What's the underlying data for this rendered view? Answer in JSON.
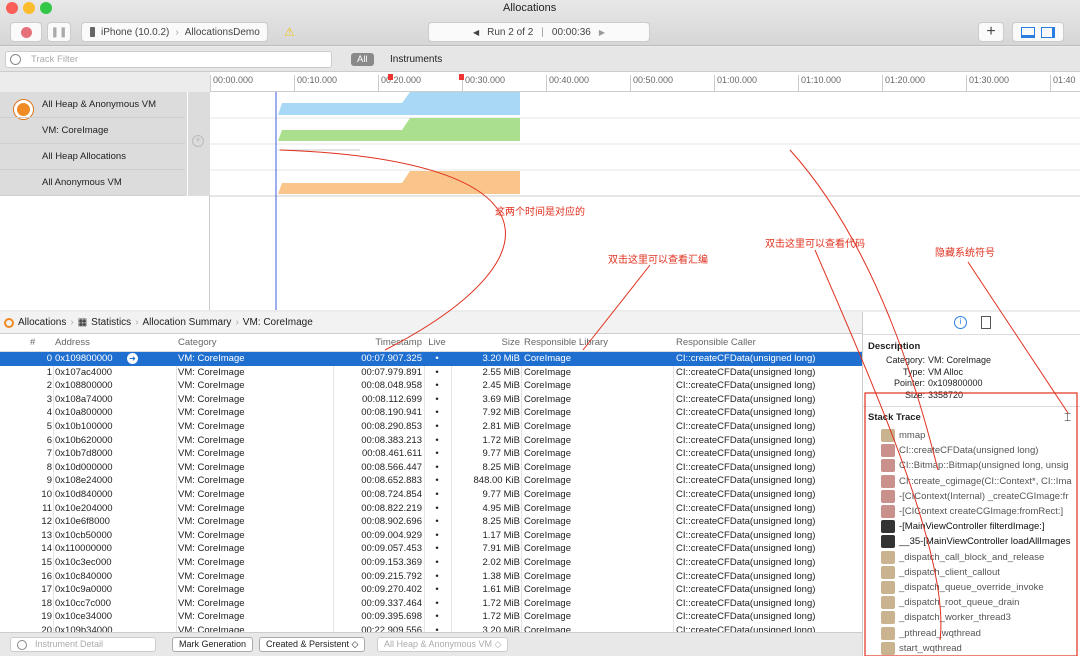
{
  "window": {
    "title": "Allocations",
    "device": "iPhone (10.0.2)",
    "target": "AllocationsDemo",
    "run": "Run 2 of 2",
    "elapsed": "00:00:36",
    "prev": "◀",
    "next": "▶",
    "add": "+"
  },
  "filter": {
    "placeholder": "Track Filter",
    "all": "All",
    "instruments": "Instruments"
  },
  "ruler": [
    "00:00.000",
    "00:10.000",
    "00:20.000",
    "00:30.000",
    "00:40.000",
    "00:50.000",
    "01:00.000",
    "01:10.000",
    "01:20.000",
    "01:30.000",
    "01:40"
  ],
  "tracks": [
    "All Heap & Anonymous VM",
    "VM: CoreImage",
    "All Heap Allocations",
    "All Anonymous VM"
  ],
  "colors": {
    "blue": "#a8d8f5",
    "green": "#a9df8d",
    "orange": "#f9c58b",
    "selection": "#1f6fd0",
    "annotation": "#e0301e"
  },
  "breadcrumb": [
    "Allocations",
    "Statistics",
    "Allocation Summary",
    "VM: CoreImage"
  ],
  "table": {
    "headers": [
      "#",
      "Address",
      "Category",
      "Timestamp",
      "Live",
      "Size",
      "Responsible Library",
      "Responsible Caller"
    ],
    "rows": [
      [
        "0",
        "0x109800000",
        "VM: CoreImage",
        "00:07.907.325",
        "•",
        "3.20 MiB",
        "CoreImage",
        "CI::createCFData(unsigned long)"
      ],
      [
        "1",
        "0x107ac4000",
        "VM: CoreImage",
        "00:07.979.891",
        "•",
        "2.55 MiB",
        "CoreImage",
        "CI::createCFData(unsigned long)"
      ],
      [
        "2",
        "0x108800000",
        "VM: CoreImage",
        "00:08.048.958",
        "•",
        "2.45 MiB",
        "CoreImage",
        "CI::createCFData(unsigned long)"
      ],
      [
        "3",
        "0x108a74000",
        "VM: CoreImage",
        "00:08.112.699",
        "•",
        "3.69 MiB",
        "CoreImage",
        "CI::createCFData(unsigned long)"
      ],
      [
        "4",
        "0x10a800000",
        "VM: CoreImage",
        "00:08.190.941",
        "•",
        "7.92 MiB",
        "CoreImage",
        "CI::createCFData(unsigned long)"
      ],
      [
        "5",
        "0x10b100000",
        "VM: CoreImage",
        "00:08.290.853",
        "•",
        "2.81 MiB",
        "CoreImage",
        "CI::createCFData(unsigned long)"
      ],
      [
        "6",
        "0x10b620000",
        "VM: CoreImage",
        "00:08.383.213",
        "•",
        "1.72 MiB",
        "CoreImage",
        "CI::createCFData(unsigned long)"
      ],
      [
        "7",
        "0x10b7d8000",
        "VM: CoreImage",
        "00:08.461.611",
        "•",
        "9.77 MiB",
        "CoreImage",
        "CI::createCFData(unsigned long)"
      ],
      [
        "8",
        "0x10d000000",
        "VM: CoreImage",
        "00:08.566.447",
        "•",
        "8.25 MiB",
        "CoreImage",
        "CI::createCFData(unsigned long)"
      ],
      [
        "9",
        "0x108e24000",
        "VM: CoreImage",
        "00:08.652.883",
        "•",
        "848.00 KiB",
        "CoreImage",
        "CI::createCFData(unsigned long)"
      ],
      [
        "10",
        "0x10d840000",
        "VM: CoreImage",
        "00:08.724.854",
        "•",
        "9.77 MiB",
        "CoreImage",
        "CI::createCFData(unsigned long)"
      ],
      [
        "11",
        "0x10e204000",
        "VM: CoreImage",
        "00:08.822.219",
        "•",
        "4.95 MiB",
        "CoreImage",
        "CI::createCFData(unsigned long)"
      ],
      [
        "12",
        "0x10e6f8000",
        "VM: CoreImage",
        "00:08.902.696",
        "•",
        "8.25 MiB",
        "CoreImage",
        "CI::createCFData(unsigned long)"
      ],
      [
        "13",
        "0x10cb50000",
        "VM: CoreImage",
        "00:09.004.929",
        "•",
        "1.17 MiB",
        "CoreImage",
        "CI::createCFData(unsigned long)"
      ],
      [
        "14",
        "0x110000000",
        "VM: CoreImage",
        "00:09.057.453",
        "•",
        "7.91 MiB",
        "CoreImage",
        "CI::createCFData(unsigned long)"
      ],
      [
        "15",
        "0x10c3ec000",
        "VM: CoreImage",
        "00:09.153.369",
        "•",
        "2.02 MiB",
        "CoreImage",
        "CI::createCFData(unsigned long)"
      ],
      [
        "16",
        "0x10c840000",
        "VM: CoreImage",
        "00:09.215.792",
        "•",
        "1.38 MiB",
        "CoreImage",
        "CI::createCFData(unsigned long)"
      ],
      [
        "17",
        "0x10c9a0000",
        "VM: CoreImage",
        "00:09.270.402",
        "•",
        "1.61 MiB",
        "CoreImage",
        "CI::createCFData(unsigned long)"
      ],
      [
        "18",
        "0x10cc7c000",
        "VM: CoreImage",
        "00:09.337.464",
        "•",
        "1.72 MiB",
        "CoreImage",
        "CI::createCFData(unsigned long)"
      ],
      [
        "19",
        "0x10ce34000",
        "VM: CoreImage",
        "00:09.395.698",
        "•",
        "1.72 MiB",
        "CoreImage",
        "CI::createCFData(unsigned long)"
      ],
      [
        "20",
        "0x109b34000",
        "VM: CoreImage",
        "00:22.909.556",
        "•",
        "3.20 MiB",
        "CoreImage",
        "CI::createCFData(unsigned long)"
      ]
    ]
  },
  "bottom": {
    "detail_placeholder": "Instrument Detail",
    "mark": "Mark Generation",
    "created": "Created & Persistent ◇",
    "heap": "All Heap & Anonymous VM ◇"
  },
  "inspector": {
    "description_title": "Description",
    "fields": [
      [
        "Category:",
        "VM: CoreImage"
      ],
      [
        "Type:",
        "VM Alloc"
      ],
      [
        "Pointer:",
        "0x109800000"
      ],
      [
        "Size:",
        "3358720"
      ]
    ],
    "stack_title": "Stack Trace",
    "stack": [
      {
        "t": "sys",
        "label": "mmap"
      },
      {
        "t": "lib",
        "label": "CI::createCFData(unsigned long)"
      },
      {
        "t": "lib",
        "label": "CI::Bitmap::Bitmap(unsigned long, unsig"
      },
      {
        "t": "lib",
        "label": "CI::create_cgimage(CI::Context*, CI::Ima"
      },
      {
        "t": "lib",
        "label": "-[CIContext(Internal) _createCGImage:fr"
      },
      {
        "t": "lib",
        "label": "-[CIContext createCGImage:fromRect:]"
      },
      {
        "t": "user",
        "label": "-[MainViewController filterdImage:]"
      },
      {
        "t": "user",
        "label": "__35-[MainViewController loadAllImages"
      },
      {
        "t": "sys",
        "label": "_dispatch_call_block_and_release"
      },
      {
        "t": "sys",
        "label": "_dispatch_client_callout"
      },
      {
        "t": "sys",
        "label": "_dispatch_queue_override_invoke"
      },
      {
        "t": "sys",
        "label": "_dispatch_root_queue_drain"
      },
      {
        "t": "sys",
        "label": "_dispatch_worker_thread3"
      },
      {
        "t": "sys",
        "label": "_pthread_wqthread"
      },
      {
        "t": "sys",
        "label": "start_wqthread"
      }
    ]
  },
  "annotations": [
    "这两个时间是对应的",
    "双击这里可以查看汇编",
    "双击这里可以查看代码",
    "隐藏系统符号"
  ]
}
